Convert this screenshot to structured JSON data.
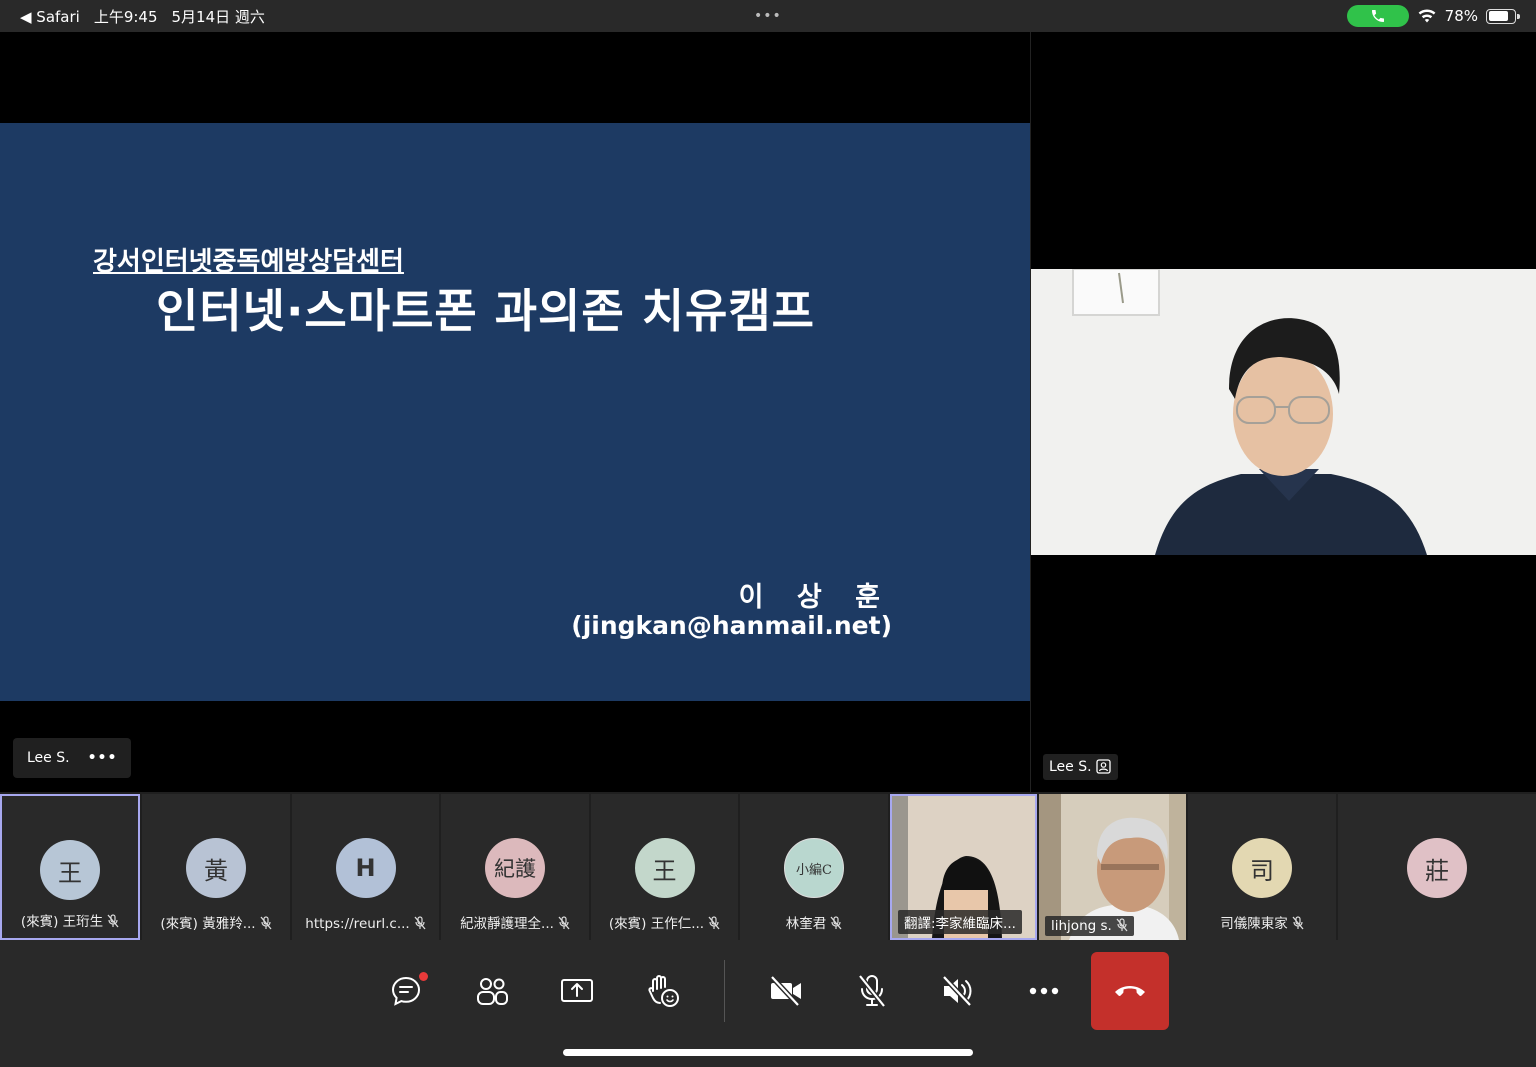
{
  "status_bar": {
    "back_app": "◀ Safari",
    "time": "上午9:45",
    "date": "5月14日 週六",
    "center_dots": "•••",
    "battery_text": "78%",
    "battery_level": 0.78
  },
  "slide": {
    "subtitle": "강서인터넷중독예방상담센터",
    "title": "인터넷·스마트폰 과의존 치유캠프",
    "presenter": "이 상 훈",
    "email": "(jingkan@hanmail.net)"
  },
  "main_stage": {
    "name": "Lee S.",
    "more": "•••"
  },
  "side_stage": {
    "name": "Lee S."
  },
  "participants": [
    {
      "initial": "王",
      "label": "(來賓) 王珩生",
      "color": "#b7c6d6"
    },
    {
      "initial": "黃",
      "label": "(來賓) 黃雅羚...",
      "color": "#b8c3d4"
    },
    {
      "initial": "H",
      "label": "https://reurl.c...",
      "color": "#b2c1d7"
    },
    {
      "initial": "紀護",
      "label": "紀淑靜護理全...",
      "color": "#dcb9bc"
    },
    {
      "initial": "王",
      "label": "(來賓) 王作仁...",
      "color": "#c3d7cb"
    },
    {
      "initial": "小編C",
      "label": "林奎君",
      "color": "#b9d7cf"
    },
    {
      "label": "翻譯:李家維臨床..."
    },
    {
      "label": "lihjong s."
    },
    {
      "initial": "司",
      "label": "司儀陳東家",
      "color": "#e3d8b2"
    },
    {
      "initial": "莊",
      "label": "",
      "color": "#e0c1c6"
    }
  ],
  "icons": {
    "chat": "chat-icon",
    "people": "people-icon",
    "share": "share-screen-icon",
    "react": "raise-hand-icon",
    "camera": "camera-off-icon",
    "mic": "mic-off-icon",
    "speaker": "speaker-off-icon",
    "more": "more-icon",
    "hangup": "hangup-icon"
  },
  "colors": {
    "slide_bg": "#1d3a63",
    "hangup": "#c4302b",
    "selected_border": "#a7a8ef",
    "call_pill": "#30c24a"
  }
}
